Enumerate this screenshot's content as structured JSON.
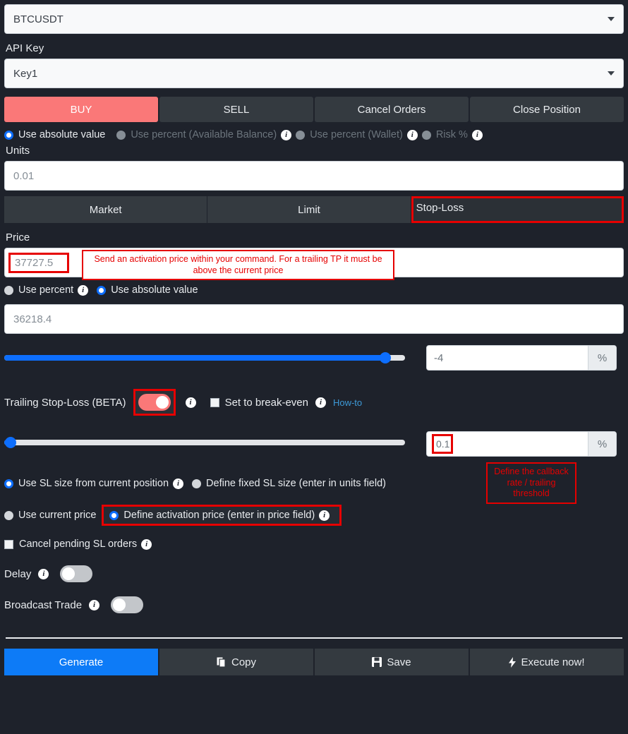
{
  "symbol": {
    "label_cut": "",
    "value": "BTCUSDT",
    "caret": "chevron-down-icon"
  },
  "api_key": {
    "label": "API Key",
    "value": "Key1"
  },
  "side_buttons": [
    {
      "label": "BUY",
      "active": true
    },
    {
      "label": "SELL",
      "active": false
    },
    {
      "label": "Cancel Orders",
      "active": false
    },
    {
      "label": "Close Position",
      "active": false
    }
  ],
  "size_mode": {
    "options": [
      {
        "label": "Use absolute value",
        "selected": true,
        "dimmed": false,
        "info": false
      },
      {
        "label": "Use percent (Available Balance)",
        "selected": false,
        "dimmed": true,
        "info": true
      },
      {
        "label": "Use percent (Wallet)",
        "selected": false,
        "dimmed": true,
        "info": true
      },
      {
        "label": "Risk %",
        "selected": false,
        "dimmed": true,
        "info": true
      }
    ]
  },
  "units": {
    "label": "Units",
    "value": "0.01"
  },
  "order_tabs": [
    {
      "label": "Market",
      "active": false,
      "highlighted": false
    },
    {
      "label": "Limit",
      "active": false,
      "highlighted": false
    },
    {
      "label": "Stop-Loss",
      "active": true,
      "highlighted": true
    }
  ],
  "price": {
    "label": "Price",
    "value": "37727.5",
    "highlighted": true,
    "annotation": "Send an activation price within your command. For a trailing TP it must be above the current price"
  },
  "sl_value_mode": {
    "options": [
      {
        "label": "Use percent",
        "selected": false,
        "info": true
      },
      {
        "label": "Use absolute value",
        "selected": true,
        "info": false
      }
    ]
  },
  "sl_price": {
    "value": "36218.4"
  },
  "sl_slider": {
    "percent_value": "-4",
    "suffix": "%",
    "fill_ratio": 0.95
  },
  "trailing": {
    "label": "Trailing Stop-Loss (BETA)",
    "toggle_on": true,
    "toggle_highlighted": true,
    "breakeven_label": "Set to break-even",
    "breakeven_checked": false,
    "howto_label": "How-to"
  },
  "callback": {
    "slider_fill_ratio": 0.01,
    "value": "0.1",
    "suffix": "%",
    "value_highlighted": true,
    "annotation": "Define the callback rate / trailing threshold"
  },
  "sl_size_mode": {
    "options": [
      {
        "label": "Use SL size from current position",
        "selected": true,
        "info": true
      },
      {
        "label": "Define fixed SL size (enter in units field)",
        "selected": false,
        "info": false
      }
    ]
  },
  "activation_mode": {
    "options": [
      {
        "label": "Use current price",
        "selected": false,
        "info": false,
        "highlighted": false
      },
      {
        "label": "Define activation price (enter in price field)",
        "selected": true,
        "info": true,
        "highlighted": true
      }
    ]
  },
  "cancel_pending": {
    "label": "Cancel pending SL orders",
    "checked": false
  },
  "delay": {
    "label": "Delay",
    "toggle_on": false
  },
  "broadcast": {
    "label": "Broadcast Trade",
    "toggle_on": false
  },
  "footer": [
    {
      "label": "Generate",
      "icon": "",
      "primary": true
    },
    {
      "label": "Copy",
      "icon": "copy-icon",
      "primary": false
    },
    {
      "label": "Save",
      "icon": "save-icon",
      "primary": false
    },
    {
      "label": "Execute now!",
      "icon": "lightning-icon",
      "primary": false
    }
  ],
  "colors": {
    "background": "#1e222b",
    "accent_buy": "#fa7878",
    "accent_blue": "#0d6efd",
    "annotation_red": "#e60000",
    "panel": "#343a40"
  }
}
